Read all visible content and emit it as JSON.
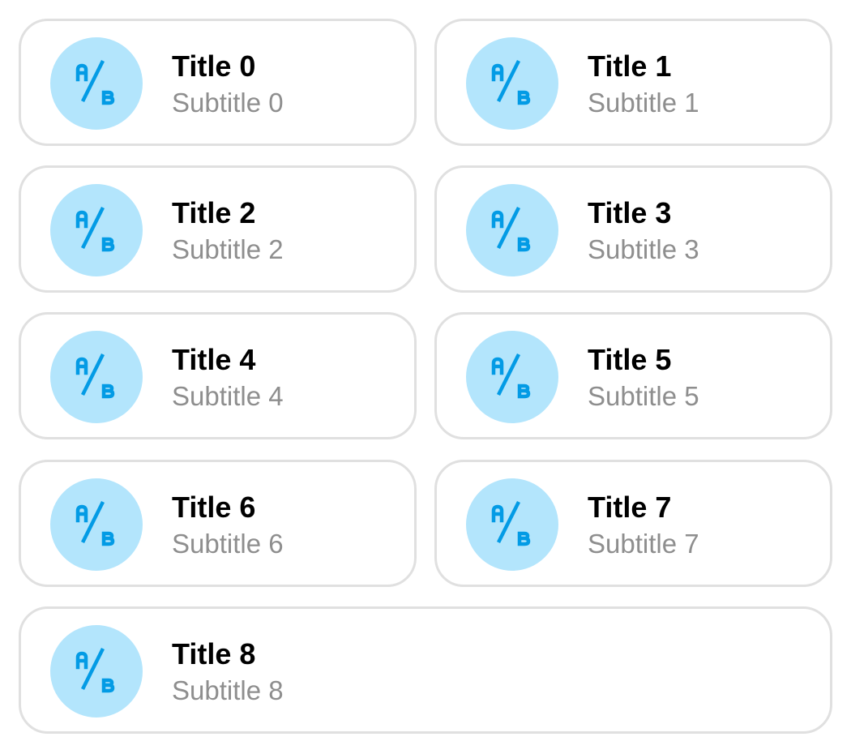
{
  "colors": {
    "avatar_bg": "#b3e5fc",
    "icon": "#039be5",
    "card_border": "#e0e0e0",
    "title": "#000000",
    "subtitle": "#8e8e8e"
  },
  "items": [
    {
      "title": "Title 0",
      "subtitle": "Subtitle 0",
      "icon": "a-b-icon"
    },
    {
      "title": "Title 1",
      "subtitle": "Subtitle 1",
      "icon": "a-b-icon"
    },
    {
      "title": "Title 2",
      "subtitle": "Subtitle 2",
      "icon": "a-b-icon"
    },
    {
      "title": "Title 3",
      "subtitle": "Subtitle 3",
      "icon": "a-b-icon"
    },
    {
      "title": "Title 4",
      "subtitle": "Subtitle 4",
      "icon": "a-b-icon"
    },
    {
      "title": "Title 5",
      "subtitle": "Subtitle 5",
      "icon": "a-b-icon"
    },
    {
      "title": "Title 6",
      "subtitle": "Subtitle 6",
      "icon": "a-b-icon"
    },
    {
      "title": "Title 7",
      "subtitle": "Subtitle 7",
      "icon": "a-b-icon"
    },
    {
      "title": "Title 8",
      "subtitle": "Subtitle 8",
      "icon": "a-b-icon"
    }
  ]
}
